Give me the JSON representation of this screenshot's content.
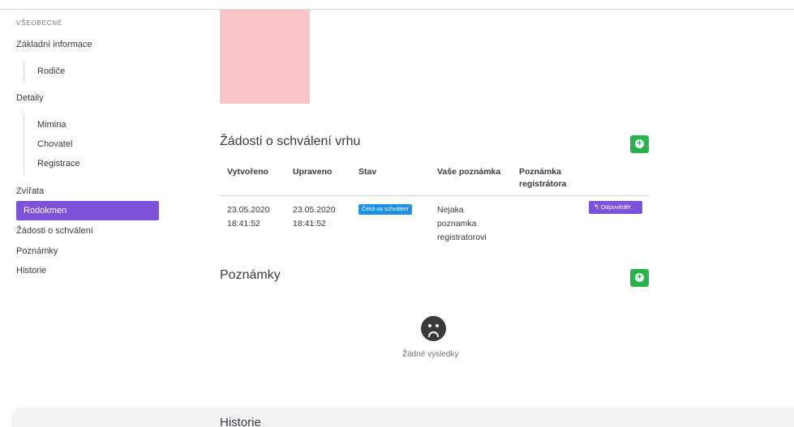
{
  "sidebar": {
    "section_label": "VŠEOBECNÉ",
    "items": {
      "zakladni": "Základní informace",
      "rodice": "Rodiče",
      "detaily": "Detaily",
      "mimina": "Mimina",
      "chovatel": "Chovatel",
      "registrace": "Registrace",
      "zvirata": "Zvířata",
      "rodokmen": "Rodokmen",
      "zadosti": "Žádosti o schválení",
      "poznamky": "Poznámky",
      "historie": "Historie"
    },
    "active_item": "Rodokmen",
    "accent_color": "#7c52d9"
  },
  "requests": {
    "title": "Žádosti o schválení vrhu",
    "add_icon": "plus-circle-icon",
    "columns": {
      "created": "Vytvořeno",
      "updated": "Upraveno",
      "status": "Stav",
      "your_note": "Vaše poznámka",
      "registrar_note": "Poznámka registrátora"
    },
    "rows": [
      {
        "created": "23.05.2020 18:41:52",
        "updated": "23.05.2020 18:41:52",
        "status": "Čeká na schválení",
        "your_note": "Nejaka poznamka registratorovi",
        "registrar_note": "",
        "action_icon": "reply-icon",
        "action_label": "Odpovědět"
      }
    ]
  },
  "notes": {
    "title": "Poznámky",
    "add_icon": "plus-circle-icon",
    "empty_icon": "sad-face-icon",
    "empty_text": "Žádné výsledky"
  },
  "history": {
    "title": "Historie"
  },
  "colors": {
    "add_button": "#28b34a",
    "status_badge": "#1f8fe6",
    "image_placeholder": "#f9c4c8"
  }
}
